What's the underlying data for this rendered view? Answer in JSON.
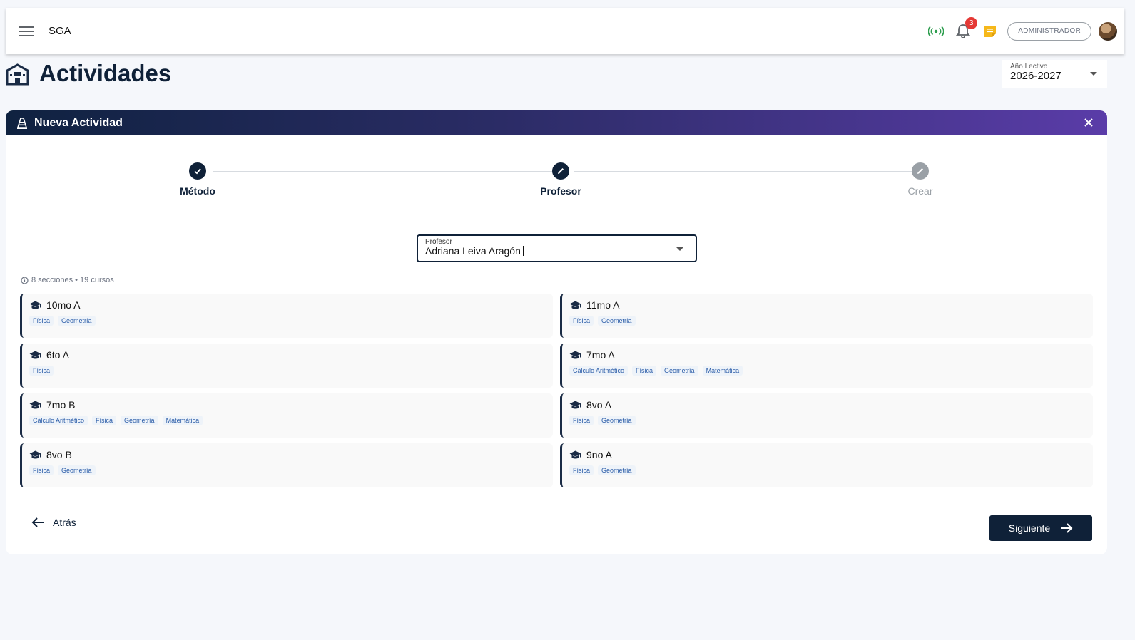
{
  "header": {
    "app_name": "SGA",
    "notifications_count": "3",
    "role": "ADMINISTRADOR"
  },
  "page": {
    "title": "Actividades",
    "year_label": "Año Lectivo",
    "year_value": "2026-2027"
  },
  "card": {
    "title": "Nueva Actividad"
  },
  "stepper": {
    "steps": [
      {
        "label": "Método",
        "state": "done"
      },
      {
        "label": "Profesor",
        "state": "active"
      },
      {
        "label": "Crear",
        "state": "inactive"
      }
    ]
  },
  "professor_select": {
    "label": "Profesor",
    "value": "Adriana Leiva Aragón"
  },
  "summary": "8 secciones • 19 cursos",
  "sections": [
    {
      "name": "10mo A",
      "courses": [
        "Física",
        "Geometría"
      ]
    },
    {
      "name": "11mo A",
      "courses": [
        "Física",
        "Geometría"
      ]
    },
    {
      "name": "6to A",
      "courses": [
        "Física"
      ]
    },
    {
      "name": "7mo A",
      "courses": [
        "Cálculo Aritmético",
        "Física",
        "Geometría",
        "Matemática"
      ]
    },
    {
      "name": "7mo B",
      "courses": [
        "Cálculo Aritmético",
        "Física",
        "Geometría",
        "Matemática"
      ]
    },
    {
      "name": "8vo A",
      "courses": [
        "Física",
        "Geometría"
      ]
    },
    {
      "name": "8vo B",
      "courses": [
        "Física",
        "Geometría"
      ]
    },
    {
      "name": "9no A",
      "courses": [
        "Física",
        "Geometría"
      ]
    }
  ],
  "footer": {
    "back_label": "Atrás",
    "next_label": "Siguiente"
  },
  "colors": {
    "primary": "#0f2138",
    "accent_end": "#5a3ca8",
    "tag_text": "#2c5da8",
    "badge": "#e53935",
    "wireless": "#2e9e4f",
    "note": "#f6b81a"
  }
}
